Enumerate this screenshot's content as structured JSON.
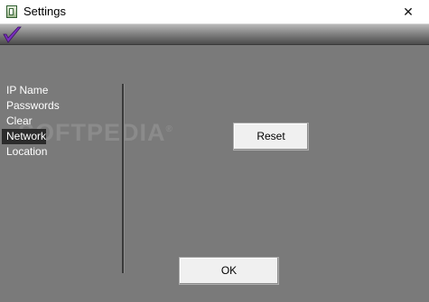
{
  "window": {
    "title": "Settings",
    "close_glyph": "✕",
    "app_icon": "settings-app-icon",
    "background_color": "#7a7a7a"
  },
  "banner": {
    "logo": "checkmark-logo-icon",
    "logo_color": "#7b2fbf"
  },
  "menu": {
    "items": [
      {
        "label": "IP Name",
        "selected": false
      },
      {
        "label": "Passwords",
        "selected": false
      },
      {
        "label": "Clear",
        "selected": false
      },
      {
        "label": "Network",
        "selected": true
      },
      {
        "label": "Location",
        "selected": false
      }
    ]
  },
  "watermark": {
    "text": "SOFTPEDIA",
    "mark": "®"
  },
  "buttons": {
    "reset_label": "Reset",
    "ok_label": "OK"
  }
}
